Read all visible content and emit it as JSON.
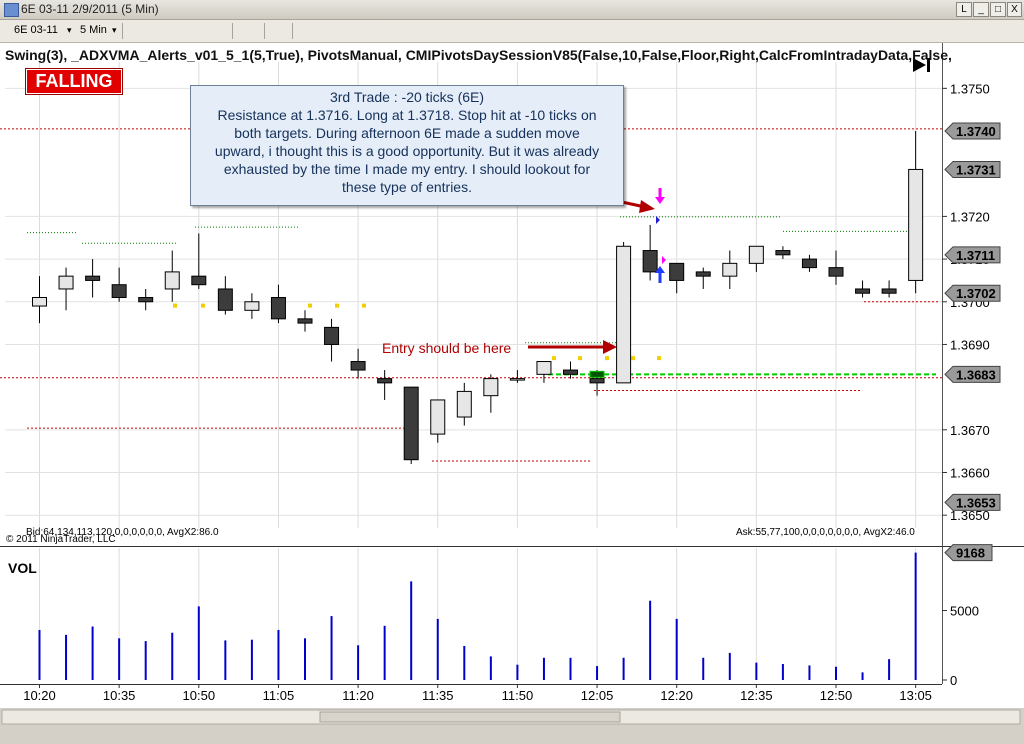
{
  "window": {
    "title": "6E 03-11  2/9/2011 (5 Min)",
    "buttons": [
      "L",
      "_",
      "□",
      "X"
    ]
  },
  "toolbar": {
    "instrument": "6E 03-11",
    "interval": "5 Min"
  },
  "indicator_title": "Swing(3),  _ADXVMA_Alerts_v01_5_1(5,True),  PivotsManual,  CMIPivotsDaySessionV85(False,10,False,Floor,Right,CalcFromIntradayData,False,",
  "signal_badge": "FALLING",
  "annotation": {
    "lines": [
      "3rd Trade : -20 ticks (6E)",
      "Resistance at 1.3716. Long at 1.3718. Stop hit at -10 ticks on",
      "both targets. During afternoon 6E made a sudden move",
      "upward, i thought this is a good opportunity. But it was already",
      "exhausted by the time I made my entry. I should lookout for",
      "these type of entries."
    ]
  },
  "entry_note": "Entry should be here",
  "footer": {
    "bid_text": "Bid:64,134,113,120,0,0,0,0,0,0, AvgX2:86.0",
    "ask_text": "Ask:55,77,100,0,0,0,0,0,0,0, AvgX2:46.0",
    "copyright": "© 2011 NinjaTrader, LLC"
  },
  "chart_data": {
    "type": "candlestick",
    "price_axis": {
      "min": 1.3647,
      "max": 1.3755,
      "ticks": [
        "1.3750",
        "1.3720",
        "1.3710",
        "1.3700",
        "1.3690",
        "1.3670",
        "1.3660",
        "1.3650"
      ],
      "tick_values": [
        1.375,
        1.372,
        1.371,
        1.37,
        1.369,
        1.367,
        1.366,
        1.365
      ]
    },
    "price_markers": [
      {
        "label": "1.3740",
        "value": 1.374
      },
      {
        "label": "1.3731",
        "value": 1.3731
      },
      {
        "label": "1.3711",
        "value": 1.3711
      },
      {
        "label": "1.3702",
        "value": 1.3702
      },
      {
        "label": "1.3683",
        "value": 1.3683
      },
      {
        "label": "1.3653",
        "value": 1.3653
      }
    ],
    "candles": [
      {
        "o": 1.3699,
        "h": 1.3706,
        "l": 1.3695,
        "c": 1.3701
      },
      {
        "o": 1.3703,
        "h": 1.3708,
        "l": 1.3698,
        "c": 1.3706
      },
      {
        "o": 1.3706,
        "h": 1.371,
        "l": 1.3701,
        "c": 1.3705
      },
      {
        "o": 1.3704,
        "h": 1.3708,
        "l": 1.37,
        "c": 1.3701
      },
      {
        "o": 1.3701,
        "h": 1.3703,
        "l": 1.3698,
        "c": 1.37
      },
      {
        "o": 1.3703,
        "h": 1.3712,
        "l": 1.37,
        "c": 1.3707
      },
      {
        "o": 1.3706,
        "h": 1.3716,
        "l": 1.3703,
        "c": 1.3704
      },
      {
        "o": 1.3703,
        "h": 1.3706,
        "l": 1.3697,
        "c": 1.3698
      },
      {
        "o": 1.3698,
        "h": 1.3702,
        "l": 1.3696,
        "c": 1.37
      },
      {
        "o": 1.3701,
        "h": 1.3704,
        "l": 1.3695,
        "c": 1.3696
      },
      {
        "o": 1.3696,
        "h": 1.3698,
        "l": 1.3693,
        "c": 1.3695
      },
      {
        "o": 1.3694,
        "h": 1.3696,
        "l": 1.3686,
        "c": 1.369
      },
      {
        "o": 1.3686,
        "h": 1.3689,
        "l": 1.3682,
        "c": 1.3684
      },
      {
        "o": 1.3682,
        "h": 1.3684,
        "l": 1.3677,
        "c": 1.3681
      },
      {
        "o": 1.368,
        "h": 1.368,
        "l": 1.3662,
        "c": 1.3663
      },
      {
        "o": 1.3669,
        "h": 1.3677,
        "l": 1.3667,
        "c": 1.3677
      },
      {
        "o": 1.3673,
        "h": 1.3681,
        "l": 1.3671,
        "c": 1.3679
      },
      {
        "o": 1.3678,
        "h": 1.3683,
        "l": 1.3674,
        "c": 1.3682
      },
      {
        "o": 1.3682,
        "h": 1.3684,
        "l": 1.3681,
        "c": 1.3682
      },
      {
        "o": 1.3683,
        "h": 1.3686,
        "l": 1.3681,
        "c": 1.3686
      },
      {
        "o": 1.3684,
        "h": 1.3686,
        "l": 1.3682,
        "c": 1.3683
      },
      {
        "o": 1.3682,
        "h": 1.3684,
        "l": 1.3678,
        "c": 1.3681
      },
      {
        "o": 1.3681,
        "h": 1.3714,
        "l": 1.3681,
        "c": 1.3713
      },
      {
        "o": 1.3712,
        "h": 1.3718,
        "l": 1.3705,
        "c": 1.3707
      },
      {
        "o": 1.3709,
        "h": 1.3709,
        "l": 1.3702,
        "c": 1.3705
      },
      {
        "o": 1.3707,
        "h": 1.3708,
        "l": 1.3703,
        "c": 1.3706
      },
      {
        "o": 1.3706,
        "h": 1.3712,
        "l": 1.3703,
        "c": 1.3709
      },
      {
        "o": 1.3709,
        "h": 1.3713,
        "l": 1.3707,
        "c": 1.3713
      },
      {
        "o": 1.3712,
        "h": 1.3713,
        "l": 1.371,
        "c": 1.3711
      },
      {
        "o": 1.371,
        "h": 1.3711,
        "l": 1.3707,
        "c": 1.3708
      },
      {
        "o": 1.3708,
        "h": 1.3712,
        "l": 1.3704,
        "c": 1.3706
      },
      {
        "o": 1.3703,
        "h": 1.3705,
        "l": 1.3701,
        "c": 1.3702
      },
      {
        "o": 1.3703,
        "h": 1.3705,
        "l": 1.3701,
        "c": 1.3702
      },
      {
        "o": 1.3705,
        "h": 1.374,
        "l": 1.3702,
        "c": 1.3731
      }
    ],
    "time_labels": [
      "10:20",
      "10:35",
      "10:50",
      "11:05",
      "11:20",
      "11:35",
      "11:50",
      "12:05",
      "12:20",
      "12:35",
      "12:50",
      "13:05"
    ],
    "volume_panel": {
      "title": "VOL",
      "ticks": [
        "5000",
        "0"
      ],
      "tick_values": [
        5000,
        0
      ],
      "max": 9500,
      "last_label": "9168",
      "values": [
        3600,
        3250,
        3850,
        3000,
        2800,
        3400,
        5300,
        2850,
        2900,
        3600,
        3000,
        4600,
        2500,
        3900,
        7100,
        4400,
        2450,
        1700,
        1100,
        1600,
        1600,
        1000,
        1600,
        5700,
        4400,
        1600,
        1950,
        1250,
        1150,
        1050,
        950,
        550,
        1500,
        9168
      ]
    },
    "colors": {
      "bull_body": "#e6e6e6",
      "bear_body": "#3c3c3c",
      "volume_bar": "#0000cc",
      "pivot_line": "#cc0000",
      "swing_line": "#008000",
      "dots": "#f0d000",
      "position_line": "#00cc00"
    }
  }
}
